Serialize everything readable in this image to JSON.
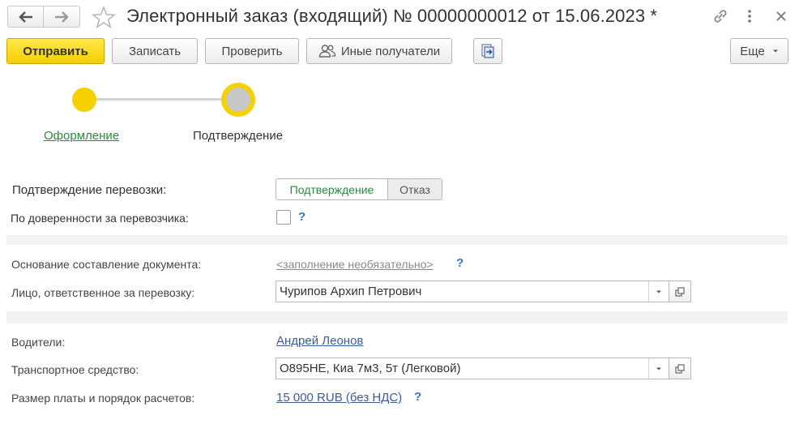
{
  "window": {
    "title": "Электронный заказ (входящий) № 00000000012 от 15.06.2023 *"
  },
  "toolbar": {
    "send": "Отправить",
    "write": "Записать",
    "check": "Проверить",
    "other_recipients": "Иные получатели",
    "more": "Еще"
  },
  "steps": [
    {
      "label": "Оформление",
      "state": "done"
    },
    {
      "label": "Подтверждение",
      "state": "current"
    }
  ],
  "form": {
    "transport_confirm": {
      "label": "Подтверждение перевозки:",
      "options": [
        "Подтверждение",
        "Отказ"
      ],
      "selected": "Подтверждение"
    },
    "by_proxy": {
      "label": "По доверенности за перевозчика:",
      "checked": false,
      "help": "?"
    },
    "document_basis": {
      "label": "Основание составление документа:",
      "placeholder": "<заполнение необязательно>",
      "help": "?"
    },
    "responsible_person": {
      "label": "Лицо, ответственное за перевозку:",
      "value": "Чурипов Архип Петрович"
    },
    "drivers": {
      "label": "Водители:",
      "value": "Андрей Леонов"
    },
    "vehicle": {
      "label": "Транспортное средство:",
      "value": "О895НЕ, Киа  7м3, 5т (Легковой)"
    },
    "payment": {
      "label": "Размер платы и порядок расчетов:",
      "value": "15 000 RUB (без НДС)",
      "help": "?"
    }
  },
  "colors": {
    "accent_yellow": "#f5d100",
    "link_blue": "#3b5b9b",
    "link_green": "#2a8a3c",
    "help_blue": "#3b76c8"
  }
}
